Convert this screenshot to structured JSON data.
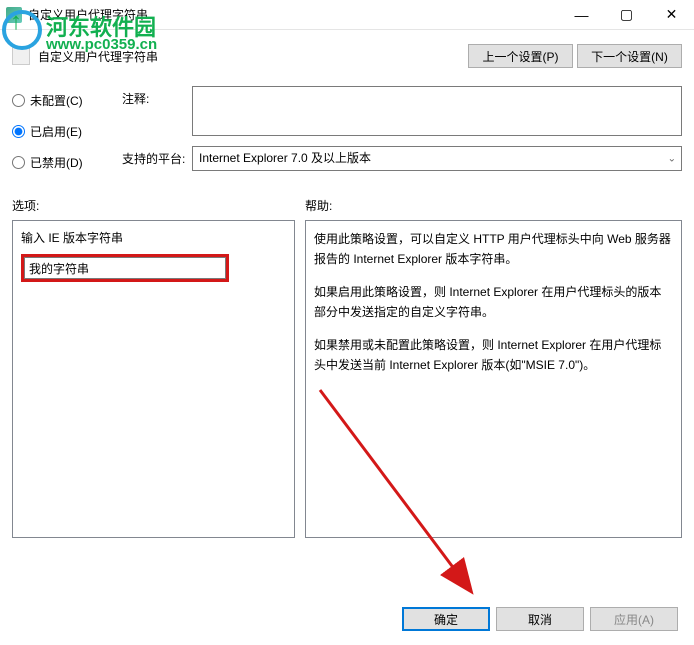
{
  "window": {
    "title": "自定义用户代理字符串"
  },
  "header": {
    "title": "自定义用户代理字符串",
    "prev_btn": "上一个设置(P)",
    "next_btn": "下一个设置(N)"
  },
  "radios": {
    "not_configured": "未配置(C)",
    "enabled": "已启用(E)",
    "disabled": "已禁用(D)"
  },
  "fields": {
    "comment_label": "注释:",
    "platform_label": "支持的平台:",
    "platform_value": "Internet Explorer 7.0 及以上版本"
  },
  "sections": {
    "options_label": "选项:",
    "help_label": "帮助:"
  },
  "options": {
    "input_label": "输入 IE 版本字符串",
    "input_value": "我的字符串"
  },
  "help": {
    "p1": "使用此策略设置，可以自定义 HTTP 用户代理标头中向 Web 服务器报告的 Internet Explorer 版本字符串。",
    "p2": "如果启用此策略设置，则 Internet Explorer 在用户代理标头的版本部分中发送指定的自定义字符串。",
    "p3": "如果禁用或未配置此策略设置，则 Internet Explorer 在用户代理标头中发送当前 Internet Explorer 版本(如\"MSIE 7.0\")。"
  },
  "footer": {
    "ok": "确定",
    "cancel": "取消",
    "apply": "应用(A)"
  },
  "watermark": {
    "text": "河东软件园",
    "url": "www.pc0359.cn"
  }
}
